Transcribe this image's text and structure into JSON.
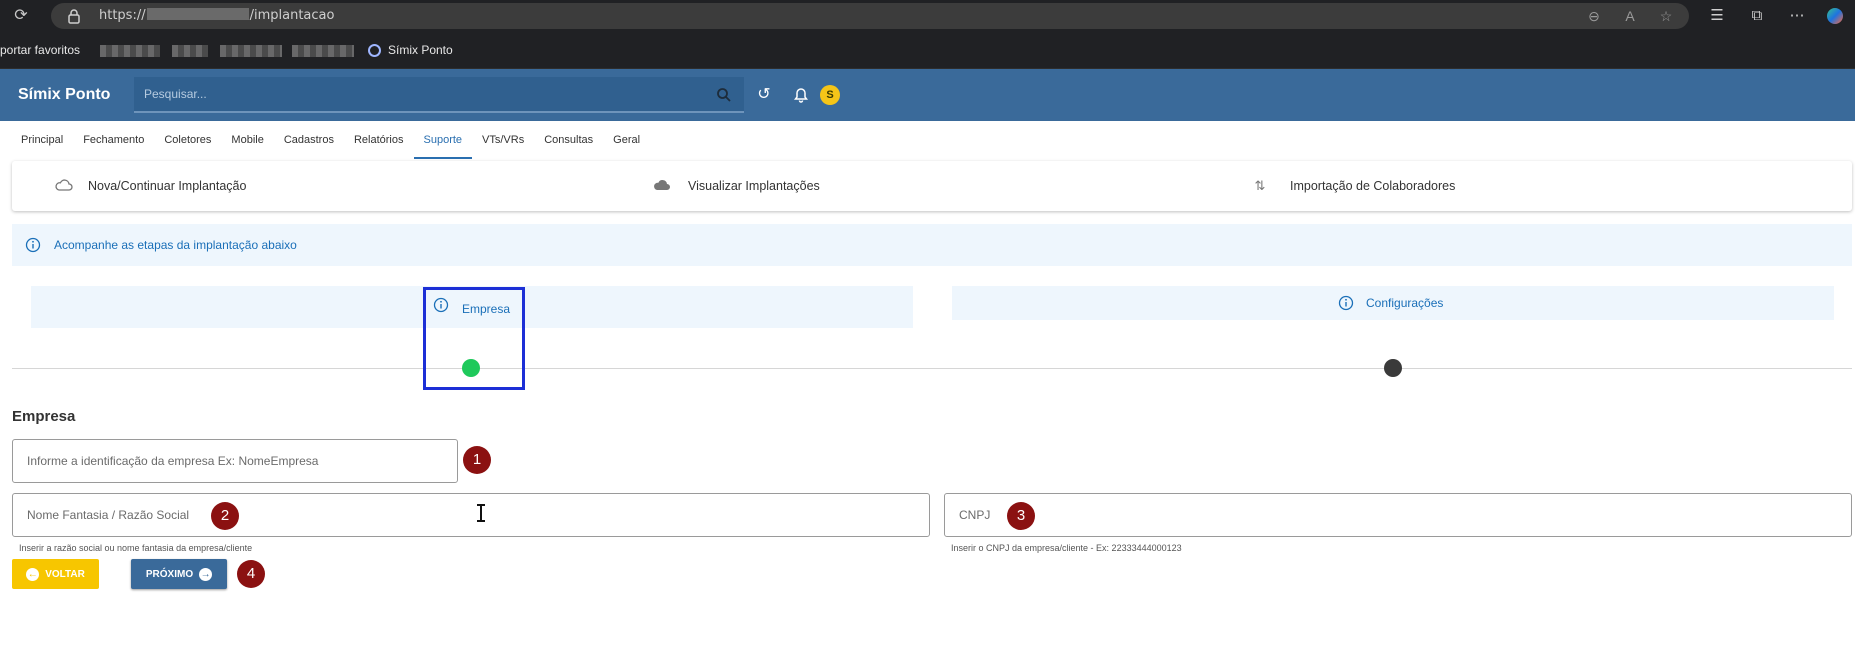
{
  "browser": {
    "url_prefix": "https://",
    "url_suffix": "/implantacao",
    "bookmarks": {
      "first_label": "portar favoritos",
      "simix_label": "Símix Ponto"
    }
  },
  "app": {
    "brand": "Símix Ponto",
    "search_placeholder": "Pesquisar...",
    "avatar_initial": "S"
  },
  "menu": {
    "tabs": [
      {
        "label": "Principal"
      },
      {
        "label": "Fechamento"
      },
      {
        "label": "Coletores"
      },
      {
        "label": "Mobile"
      },
      {
        "label": "Cadastros"
      },
      {
        "label": "Relatórios"
      },
      {
        "label": "Suporte",
        "active": true
      },
      {
        "label": "VTs/VRs"
      },
      {
        "label": "Consultas"
      },
      {
        "label": "Geral"
      }
    ]
  },
  "options": {
    "nova": "Nova/Continuar Implantação",
    "visualizar": "Visualizar Implantações",
    "importacao": "Importação de Colaboradores"
  },
  "banner": {
    "text": "Acompanhe as etapas da implantação abaixo"
  },
  "steps": {
    "empresa": {
      "label": "Empresa",
      "status_color": "#1ec95b"
    },
    "configuracoes": {
      "label": "Configurações",
      "status_color": "#3a3a3a"
    }
  },
  "form": {
    "title": "Empresa",
    "identificacao_placeholder": "Informe a identificação da empresa Ex: NomeEmpresa",
    "nome_placeholder": "Nome Fantasia / Razão Social",
    "nome_hint": "Inserir a razão social ou nome fantasia da empresa/cliente",
    "cnpj_placeholder": "CNPJ",
    "cnpj_hint": "Inserir o CNPJ da empresa/cliente - Ex: 22333444000123"
  },
  "buttons": {
    "voltar": "Voltar",
    "proximo": "Próximo"
  },
  "annotations": {
    "one": "1",
    "two": "2",
    "three": "3",
    "four": "4"
  }
}
